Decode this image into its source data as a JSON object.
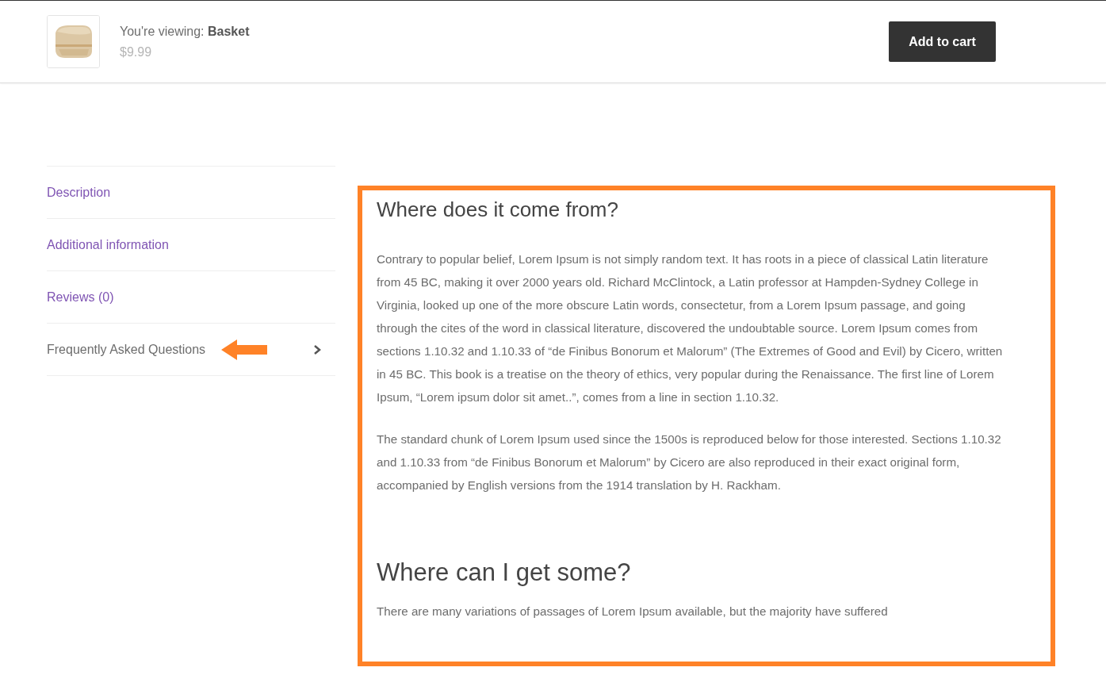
{
  "sticky_bar": {
    "viewing_label": "You're viewing:",
    "product_name": "Basket",
    "price": "$9.99",
    "button": "Add to cart"
  },
  "tabs": [
    {
      "label": "Description",
      "selected": false
    },
    {
      "label": "Additional information",
      "selected": false
    },
    {
      "label": "Reviews (0)",
      "selected": false
    },
    {
      "label": "Frequently Asked Questions",
      "selected": true
    }
  ],
  "content": [
    {
      "kind": "heading",
      "text": "Where does it come from?"
    },
    {
      "kind": "paragraph",
      "text": "Contrary to popular belief, Lorem Ipsum is not simply random text. It has roots in a piece of classical Latin literature from 45 BC, making it over 2000 years old. Richard McClintock, a Latin professor at Hampden-Sydney College in Virginia, looked up one of the more obscure Latin words, consectetur, from a Lorem Ipsum passage, and going through the cites of the word in classical literature, discovered the undoubtable source. Lorem Ipsum comes from sections 1.10.32 and 1.10.33 of “de Finibus Bonorum et Malorum” (The Extremes of Good and Evil) by Cicero, written in 45 BC. This book is a treatise on the theory of ethics, very popular during the Renaissance. The first line of Lorem Ipsum, “Lorem ipsum dolor sit amet..”, comes from a line in section 1.10.32."
    },
    {
      "kind": "paragraph",
      "text": "The standard chunk of Lorem Ipsum used since the 1500s is reproduced below for those interested. Sections 1.10.32 and 1.10.33 from “de Finibus Bonorum et Malorum” by Cicero are also reproduced in their exact original form, accompanied by English versions from the 1914 translation by H. Rackham."
    },
    {
      "kind": "heading",
      "text": "Where can I get some?"
    },
    {
      "kind": "paragraph",
      "text": "There are many variations of passages of Lorem Ipsum available, but the majority have suffered"
    }
  ]
}
